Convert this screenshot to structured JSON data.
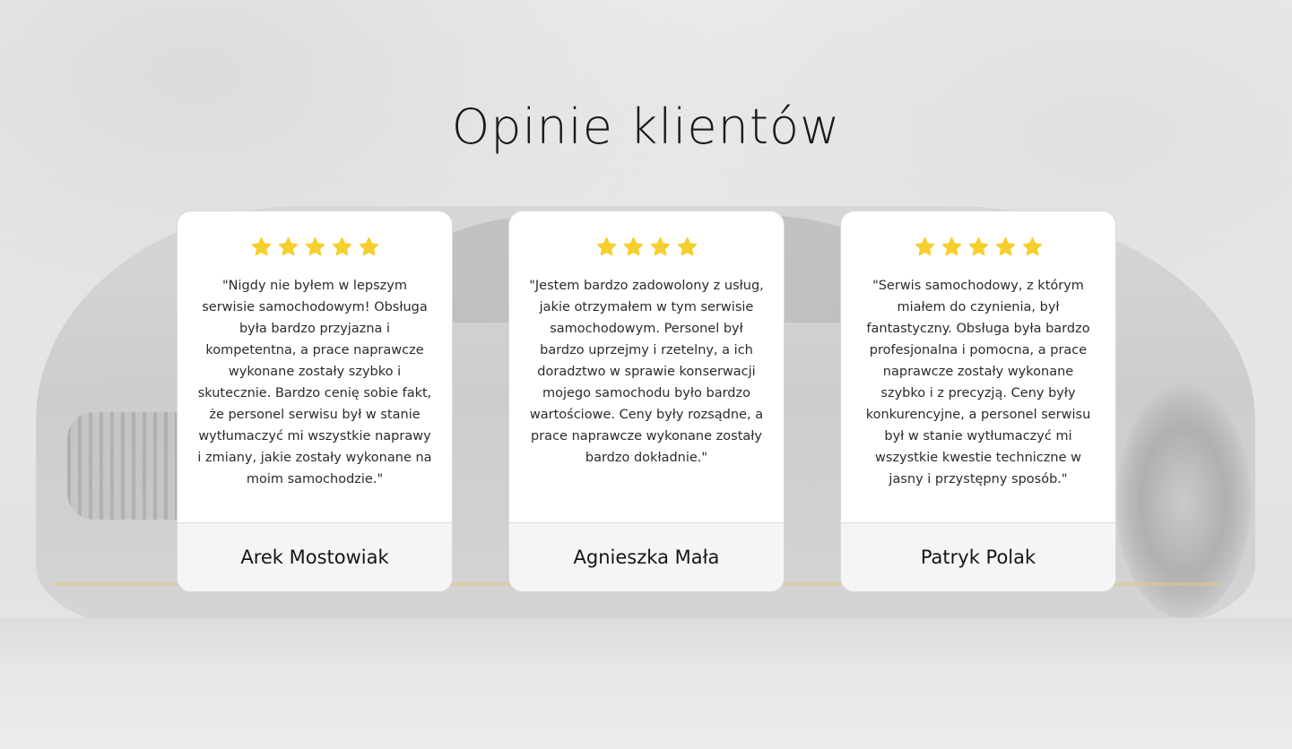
{
  "testimonials": {
    "heading": "Opinie klientów",
    "star_color": "#f5cf2e",
    "star_icon": "star-icon",
    "cards": [
      {
        "rating": 5,
        "text": "\"Nigdy nie byłem w lepszym serwisie samochodowym! Obsługa była bardzo przyjazna i kompetentna, a prace naprawcze wykonane zostały szybko i skutecznie. Bardzo cenię sobie fakt, że personel serwisu był w stanie wytłumaczyć mi wszystkie naprawy i zmiany, jakie zostały wykonane na moim samochodzie.\"",
        "author": "Arek Mostowiak"
      },
      {
        "rating": 4,
        "text": "\"Jestem bardzo zadowolony z usług, jakie otrzymałem w tym serwisie samochodowym. Personel był bardzo uprzejmy i rzetelny, a ich doradztwo w sprawie konserwacji mojego samochodu było bardzo wartościowe. Ceny były rozsądne, a prace naprawcze wykonane zostały bardzo dokładnie.\"",
        "author": "Agnieszka Mała"
      },
      {
        "rating": 5,
        "text": "\"Serwis samochodowy, z którym miałem do czynienia, był fantastyczny. Obsługa była bardzo profesjonalna i pomocna, a prace naprawcze zostały wykonane szybko i z precyzją. Ceny były konkurencyjne, a personel serwisu był w stanie wytłumaczyć mi wszystkie kwestie techniczne w jasny i przystępny sposób.\"",
        "author": "Patryk Polak"
      }
    ]
  }
}
